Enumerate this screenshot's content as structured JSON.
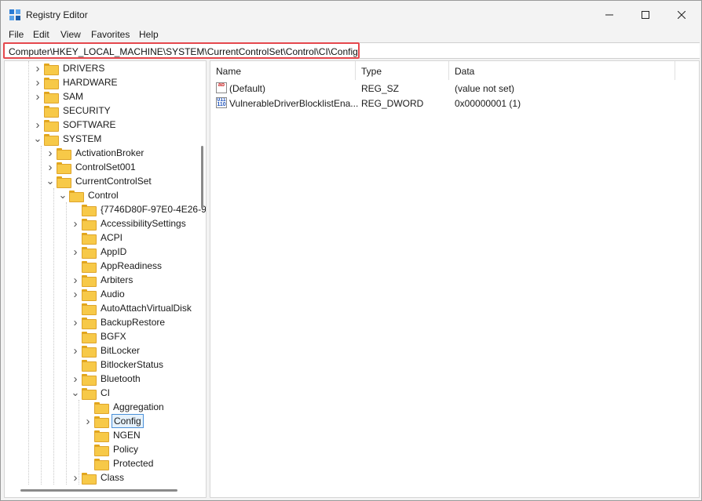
{
  "window": {
    "title": "Registry Editor"
  },
  "icons": {
    "app": "registry-editor-icon",
    "minimize": "minimize-icon",
    "maximize": "maximize-icon",
    "close": "close-icon"
  },
  "menu": [
    "File",
    "Edit",
    "View",
    "Favorites",
    "Help"
  ],
  "address": "Computer\\HKEY_LOCAL_MACHINE\\SYSTEM\\CurrentControlSet\\Control\\CI\\Config",
  "tree": [
    {
      "label": "DRIVERS",
      "expander": "collapsed"
    },
    {
      "label": "HARDWARE",
      "expander": "collapsed"
    },
    {
      "label": "SAM",
      "expander": "collapsed"
    },
    {
      "label": "SECURITY",
      "expander": "none"
    },
    {
      "label": "SOFTWARE",
      "expander": "collapsed"
    },
    {
      "label": "SYSTEM",
      "expander": "expanded"
    },
    {
      "label": "ActivationBroker",
      "expander": "collapsed"
    },
    {
      "label": "ControlSet001",
      "expander": "collapsed"
    },
    {
      "label": "CurrentControlSet",
      "expander": "expanded"
    },
    {
      "label": "Control",
      "expander": "expanded"
    },
    {
      "label": "{7746D80F-97E0-4E26-9",
      "expander": "none"
    },
    {
      "label": "AccessibilitySettings",
      "expander": "collapsed"
    },
    {
      "label": "ACPI",
      "expander": "none"
    },
    {
      "label": "AppID",
      "expander": "collapsed"
    },
    {
      "label": "AppReadiness",
      "expander": "none"
    },
    {
      "label": "Arbiters",
      "expander": "collapsed"
    },
    {
      "label": "Audio",
      "expander": "collapsed"
    },
    {
      "label": "AutoAttachVirtualDisk",
      "expander": "none"
    },
    {
      "label": "BackupRestore",
      "expander": "collapsed"
    },
    {
      "label": "BGFX",
      "expander": "none"
    },
    {
      "label": "BitLocker",
      "expander": "collapsed"
    },
    {
      "label": "BitlockerStatus",
      "expander": "none"
    },
    {
      "label": "Bluetooth",
      "expander": "collapsed"
    },
    {
      "label": "CI",
      "expander": "expanded"
    },
    {
      "label": "Aggregation",
      "expander": "none"
    },
    {
      "label": "Config",
      "expander": "collapsed",
      "selected": true
    },
    {
      "label": "NGEN",
      "expander": "none"
    },
    {
      "label": "Policy",
      "expander": "none"
    },
    {
      "label": "Protected",
      "expander": "none"
    },
    {
      "label": "Class",
      "expander": "collapsed"
    }
  ],
  "columns": {
    "name": "Name",
    "type": "Type",
    "data": "Data"
  },
  "values": [
    {
      "name": "(Default)",
      "type": "REG_SZ",
      "data": "(value not set)",
      "icon": "string-value-icon"
    },
    {
      "name": "VulnerableDriverBlocklistEna...",
      "type": "REG_DWORD",
      "data": "0x00000001 (1)",
      "icon": "dword-value-icon"
    }
  ],
  "colors": {
    "highlight_border": "#e5484d",
    "folder": "#f7c948",
    "selection": "#e5f1fb"
  }
}
